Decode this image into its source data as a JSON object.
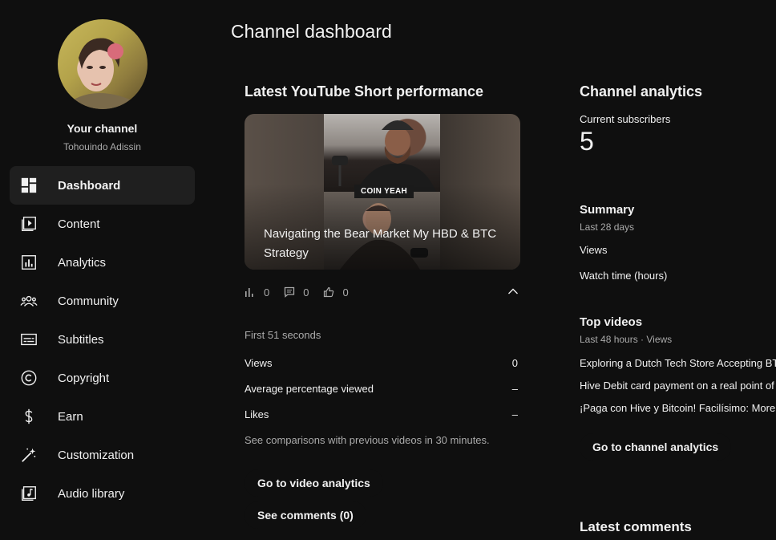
{
  "page_title": "Channel dashboard",
  "sidebar": {
    "channel_name": "Your channel",
    "channel_handle": "Tohouindo Adissin",
    "items": [
      {
        "label": "Dashboard",
        "icon": "dashboard-icon",
        "active": true
      },
      {
        "label": "Content",
        "icon": "content-icon"
      },
      {
        "label": "Analytics",
        "icon": "analytics-icon"
      },
      {
        "label": "Community",
        "icon": "community-icon"
      },
      {
        "label": "Subtitles",
        "icon": "subtitles-icon"
      },
      {
        "label": "Copyright",
        "icon": "copyright-icon"
      },
      {
        "label": "Earn",
        "icon": "dollar-icon"
      },
      {
        "label": "Customization",
        "icon": "magic-wand-icon"
      },
      {
        "label": "Audio library",
        "icon": "music-note-icon"
      }
    ]
  },
  "latest_short": {
    "heading": "Latest YouTube Short performance",
    "title": "Navigating the Bear Market My HBD & BTC Strategy",
    "badge": "COIN YEAH",
    "views_count": "0",
    "comments_count": "0",
    "likes_count": "0",
    "period": "First 51 seconds",
    "metrics": [
      {
        "label": "Views",
        "value": "0"
      },
      {
        "label": "Average percentage viewed",
        "value": "–"
      },
      {
        "label": "Likes",
        "value": "–"
      }
    ],
    "note": "See comparisons with previous videos in 30 minutes.",
    "video_analytics_button": "Go to video analytics",
    "comments_button": "See comments (0)"
  },
  "channel_analytics": {
    "heading": "Channel analytics",
    "subscribers_label": "Current subscribers",
    "subscribers_value": "5",
    "summary_heading": "Summary",
    "summary_period": "Last 28 days",
    "summary_views": "Views",
    "summary_watch_time": "Watch time (hours)",
    "top_videos_heading": "Top videos",
    "top_videos_period": "Last 48 hours · Views",
    "top_videos": [
      "Exploring a Dutch Tech Store Accepting BT",
      "Hive Debit card payment on a real point of",
      "¡Paga con Hive y Bitcoin! Facilísimo: More"
    ],
    "analytics_button": "Go to channel analytics",
    "latest_comments_heading": "Latest comments"
  },
  "colors": {
    "background": "#0f0f0f",
    "active_nav": "#1f1f1f",
    "text": "#f1f1f1",
    "muted": "#aaaaaa"
  }
}
